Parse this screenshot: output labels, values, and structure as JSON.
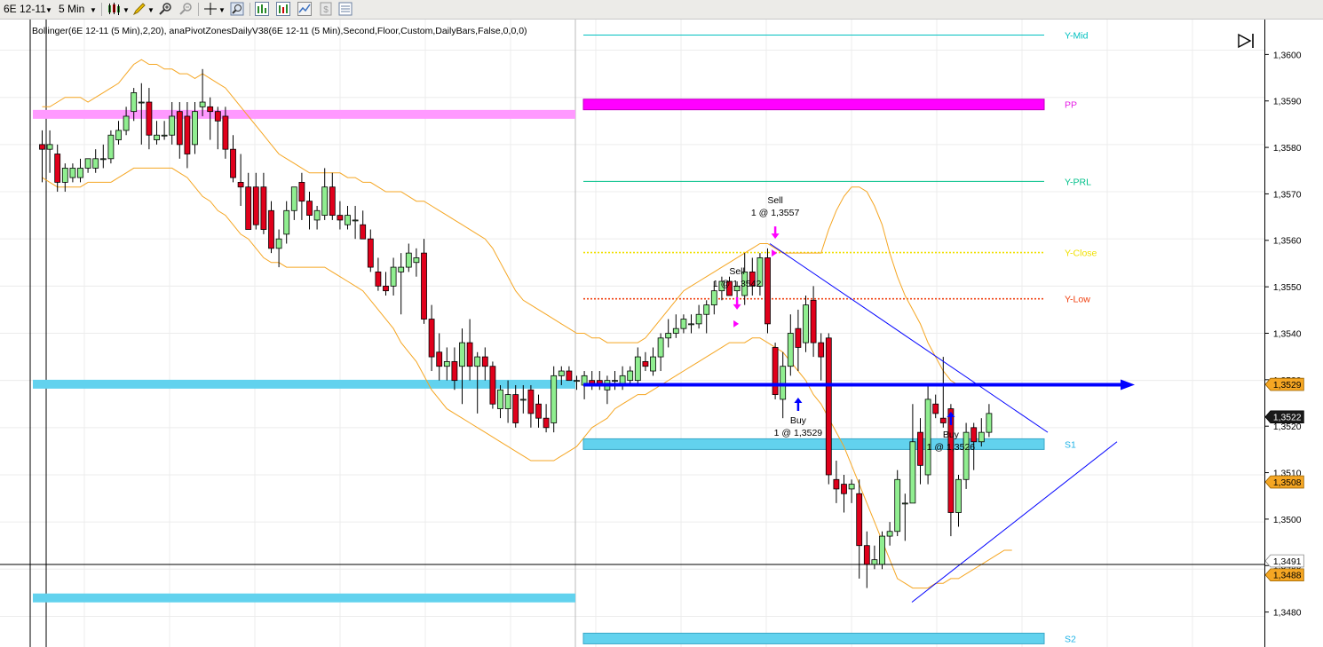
{
  "toolbar": {
    "instrument": "6E 12-11",
    "interval": "5 Min",
    "icons": [
      "candlestick-icon",
      "pencil-icon",
      "zoom-in-icon",
      "zoom-out-icon",
      "crosshair-icon",
      "magnifier-icon",
      "chart-style-icon",
      "indicator-icon",
      "strategy-icon",
      "data-box-icon",
      "properties-icon"
    ]
  },
  "colors": {
    "up_candle": "#90ee90",
    "down_candle": "#e0001b",
    "bollinger": "#f5a623",
    "pp": "#ff00ff",
    "pp_label": "#e61ee6",
    "support": "#62d2ee",
    "support_label": "#1fb3e6",
    "y_mid": "#00c0c0",
    "y_prl": "#00c08a",
    "y_close": "#f0e000",
    "y_low": "#f04010",
    "trend": "#0000ff",
    "sell_arrow": "#ff00ff",
    "buy_arrow": "#0000ff"
  },
  "chart_data": {
    "type": "candlestick",
    "indicator_label": "Bollinger(6E 12-11 (5 Min),2,20), anaPivotZonesDailyV38(6E 12-11 (5 Min),Second,Floor,Custom,DailyBars,False,0,0,0)",
    "y_axis": {
      "ylim": [
        1.34735,
        1.36065
      ],
      "ticks": [
        "1,3480",
        "1,3490",
        "1,3500",
        "1,3510",
        "1,3520",
        "1,3530",
        "1,3540",
        "1,3550",
        "1,3560",
        "1,3570",
        "1,3580",
        "1,3590",
        "1,3600"
      ],
      "tick_values": [
        1.348,
        1.349,
        1.35,
        1.351,
        1.352,
        1.353,
        1.354,
        1.355,
        1.356,
        1.357,
        1.358,
        1.359,
        1.36
      ]
    },
    "price_tags": [
      {
        "text": "1,3529",
        "value": 1.3529,
        "style": "orange"
      },
      {
        "text": "1,3522",
        "value": 1.3522,
        "style": "black"
      },
      {
        "text": "1,3508",
        "value": 1.3508,
        "style": "orange"
      },
      {
        "text": "1,3491",
        "value": 1.3491,
        "style": "gray"
      },
      {
        "text": "1,3488",
        "value": 1.3488,
        "style": "orange"
      }
    ],
    "candles": [
      {
        "o": 1.358,
        "h": 1.3583,
        "l": 1.3572,
        "c": 1.3579
      },
      {
        "o": 1.3579,
        "h": 1.3583,
        "l": 1.3574,
        "c": 1.358
      },
      {
        "o": 1.3578,
        "h": 1.358,
        "l": 1.357,
        "c": 1.3572
      },
      {
        "o": 1.3572,
        "h": 1.3576,
        "l": 1.357,
        "c": 1.3575
      },
      {
        "o": 1.3573,
        "h": 1.3576,
        "l": 1.3572,
        "c": 1.3575
      },
      {
        "o": 1.3573,
        "h": 1.3577,
        "l": 1.3572,
        "c": 1.3575
      },
      {
        "o": 1.3575,
        "h": 1.3577,
        "l": 1.3574,
        "c": 1.3577
      },
      {
        "o": 1.3575,
        "h": 1.3579,
        "l": 1.3574,
        "c": 1.3577
      },
      {
        "o": 1.3577,
        "h": 1.358,
        "l": 1.3575,
        "c": 1.3577
      },
      {
        "o": 1.3577,
        "h": 1.3583,
        "l": 1.3576,
        "c": 1.3582
      },
      {
        "o": 1.3581,
        "h": 1.3585,
        "l": 1.358,
        "c": 1.3583
      },
      {
        "o": 1.3583,
        "h": 1.3588,
        "l": 1.3582,
        "c": 1.3586
      },
      {
        "o": 1.3587,
        "h": 1.3592,
        "l": 1.3585,
        "c": 1.3591
      },
      {
        "o": 1.3589,
        "h": 1.3593,
        "l": 1.358,
        "c": 1.3589
      },
      {
        "o": 1.3589,
        "h": 1.3592,
        "l": 1.3579,
        "c": 1.3582
      },
      {
        "o": 1.3581,
        "h": 1.3585,
        "l": 1.358,
        "c": 1.3582
      },
      {
        "o": 1.3582,
        "h": 1.3585,
        "l": 1.3581,
        "c": 1.3582
      },
      {
        "o": 1.3582,
        "h": 1.3589,
        "l": 1.358,
        "c": 1.3586
      },
      {
        "o": 1.3587,
        "h": 1.3589,
        "l": 1.3577,
        "c": 1.358
      },
      {
        "o": 1.3586,
        "h": 1.3589,
        "l": 1.3575,
        "c": 1.3578
      },
      {
        "o": 1.358,
        "h": 1.3589,
        "l": 1.3578,
        "c": 1.3587
      },
      {
        "o": 1.3588,
        "h": 1.3596,
        "l": 1.3586,
        "c": 1.3589
      },
      {
        "o": 1.3588,
        "h": 1.359,
        "l": 1.3581,
        "c": 1.3587
      },
      {
        "o": 1.3587,
        "h": 1.3588,
        "l": 1.3579,
        "c": 1.3585
      },
      {
        "o": 1.3586,
        "h": 1.3588,
        "l": 1.3577,
        "c": 1.3579
      },
      {
        "o": 1.3579,
        "h": 1.3582,
        "l": 1.3572,
        "c": 1.3573
      },
      {
        "o": 1.3572,
        "h": 1.3578,
        "l": 1.3567,
        "c": 1.3571
      },
      {
        "o": 1.3571,
        "h": 1.3574,
        "l": 1.3562,
        "c": 1.3562
      },
      {
        "o": 1.3571,
        "h": 1.3574,
        "l": 1.3562,
        "c": 1.3563
      },
      {
        "o": 1.3571,
        "h": 1.3574,
        "l": 1.3561,
        "c": 1.3562
      },
      {
        "o": 1.3566,
        "h": 1.3568,
        "l": 1.3557,
        "c": 1.3558
      },
      {
        "o": 1.3558,
        "h": 1.3562,
        "l": 1.3554,
        "c": 1.356
      },
      {
        "o": 1.3561,
        "h": 1.3568,
        "l": 1.3559,
        "c": 1.3566
      },
      {
        "o": 1.3566,
        "h": 1.3571,
        "l": 1.3564,
        "c": 1.3571
      },
      {
        "o": 1.3572,
        "h": 1.3574,
        "l": 1.3564,
        "c": 1.3568
      },
      {
        "o": 1.3568,
        "h": 1.357,
        "l": 1.3562,
        "c": 1.3565
      },
      {
        "o": 1.3564,
        "h": 1.3567,
        "l": 1.3562,
        "c": 1.3566
      },
      {
        "o": 1.3565,
        "h": 1.3575,
        "l": 1.3564,
        "c": 1.3571
      },
      {
        "o": 1.3571,
        "h": 1.3574,
        "l": 1.3564,
        "c": 1.3565
      },
      {
        "o": 1.3565,
        "h": 1.3568,
        "l": 1.3562,
        "c": 1.3564
      },
      {
        "o": 1.3563,
        "h": 1.3567,
        "l": 1.3562,
        "c": 1.3565
      },
      {
        "o": 1.3564,
        "h": 1.3567,
        "l": 1.356,
        "c": 1.3564
      },
      {
        "o": 1.3563,
        "h": 1.3566,
        "l": 1.356,
        "c": 1.356
      },
      {
        "o": 1.356,
        "h": 1.3562,
        "l": 1.3553,
        "c": 1.3554
      },
      {
        "o": 1.3553,
        "h": 1.3556,
        "l": 1.3549,
        "c": 1.355
      },
      {
        "o": 1.355,
        "h": 1.3553,
        "l": 1.3548,
        "c": 1.3549
      },
      {
        "o": 1.355,
        "h": 1.3556,
        "l": 1.3548,
        "c": 1.3554
      },
      {
        "o": 1.3553,
        "h": 1.3557,
        "l": 1.3544,
        "c": 1.3554
      },
      {
        "o": 1.3554,
        "h": 1.3559,
        "l": 1.3553,
        "c": 1.3557
      },
      {
        "o": 1.3555,
        "h": 1.3558,
        "l": 1.3552,
        "c": 1.3556
      },
      {
        "o": 1.3557,
        "h": 1.356,
        "l": 1.3542,
        "c": 1.3543
      },
      {
        "o": 1.3543,
        "h": 1.3546,
        "l": 1.3532,
        "c": 1.3535
      },
      {
        "o": 1.3536,
        "h": 1.354,
        "l": 1.353,
        "c": 1.3533
      },
      {
        "o": 1.3533,
        "h": 1.3537,
        "l": 1.353,
        "c": 1.3534
      },
      {
        "o": 1.3534,
        "h": 1.3537,
        "l": 1.3528,
        "c": 1.353
      },
      {
        "o": 1.3533,
        "h": 1.3541,
        "l": 1.3525,
        "c": 1.3538
      },
      {
        "o": 1.3538,
        "h": 1.3543,
        "l": 1.353,
        "c": 1.3533
      },
      {
        "o": 1.3533,
        "h": 1.3536,
        "l": 1.3523,
        "c": 1.3535
      },
      {
        "o": 1.3535,
        "h": 1.3537,
        "l": 1.353,
        "c": 1.3533
      },
      {
        "o": 1.3533,
        "h": 1.3534,
        "l": 1.3524,
        "c": 1.3525
      },
      {
        "o": 1.3524,
        "h": 1.3529,
        "l": 1.3522,
        "c": 1.3528
      },
      {
        "o": 1.3524,
        "h": 1.353,
        "l": 1.3521,
        "c": 1.3527
      },
      {
        "o": 1.3527,
        "h": 1.3529,
        "l": 1.352,
        "c": 1.3521
      },
      {
        "o": 1.3526,
        "h": 1.3529,
        "l": 1.3523,
        "c": 1.3526
      },
      {
        "o": 1.3528,
        "h": 1.3529,
        "l": 1.352,
        "c": 1.3523
      },
      {
        "o": 1.3525,
        "h": 1.3527,
        "l": 1.352,
        "c": 1.3522
      },
      {
        "o": 1.3522,
        "h": 1.3525,
        "l": 1.3519,
        "c": 1.352
      },
      {
        "o": 1.3521,
        "h": 1.3533,
        "l": 1.3519,
        "c": 1.3531
      },
      {
        "o": 1.3531,
        "h": 1.3533,
        "l": 1.3529,
        "c": 1.3532
      },
      {
        "o": 1.3532,
        "h": 1.3533,
        "l": 1.353,
        "c": 1.353
      },
      {
        "o": 1.353,
        "h": 1.3531,
        "l": 1.3528,
        "c": 1.353
      },
      {
        "o": 1.3529,
        "h": 1.3532,
        "l": 1.3526,
        "c": 1.3531
      },
      {
        "o": 1.353,
        "h": 1.3532,
        "l": 1.3528,
        "c": 1.3529
      },
      {
        "o": 1.353,
        "h": 1.3532,
        "l": 1.3528,
        "c": 1.3529
      },
      {
        "o": 1.3528,
        "h": 1.3531,
        "l": 1.3525,
        "c": 1.353
      },
      {
        "o": 1.353,
        "h": 1.3532,
        "l": 1.3528,
        "c": 1.353
      },
      {
        "o": 1.3529,
        "h": 1.3533,
        "l": 1.3528,
        "c": 1.3531
      },
      {
        "o": 1.353,
        "h": 1.3533,
        "l": 1.3529,
        "c": 1.3532
      },
      {
        "o": 1.353,
        "h": 1.3537,
        "l": 1.3529,
        "c": 1.3535
      },
      {
        "o": 1.3534,
        "h": 1.3536,
        "l": 1.3532,
        "c": 1.3533
      },
      {
        "o": 1.3532,
        "h": 1.3537,
        "l": 1.3531,
        "c": 1.3535
      },
      {
        "o": 1.3535,
        "h": 1.354,
        "l": 1.3532,
        "c": 1.3539
      },
      {
        "o": 1.3539,
        "h": 1.3543,
        "l": 1.3537,
        "c": 1.354
      },
      {
        "o": 1.354,
        "h": 1.3544,
        "l": 1.3539,
        "c": 1.3541
      },
      {
        "o": 1.3541,
        "h": 1.3544,
        "l": 1.354,
        "c": 1.3543
      },
      {
        "o": 1.3542,
        "h": 1.3544,
        "l": 1.354,
        "c": 1.3542
      },
      {
        "o": 1.3542,
        "h": 1.3546,
        "l": 1.3541,
        "c": 1.3544
      },
      {
        "o": 1.3544,
        "h": 1.3547,
        "l": 1.354,
        "c": 1.3546
      },
      {
        "o": 1.3546,
        "h": 1.3551,
        "l": 1.3544,
        "c": 1.3549
      },
      {
        "o": 1.3549,
        "h": 1.3552,
        "l": 1.3547,
        "c": 1.3551
      },
      {
        "o": 1.3551,
        "h": 1.3552,
        "l": 1.3548,
        "c": 1.3548
      },
      {
        "o": 1.3549,
        "h": 1.3551,
        "l": 1.3547,
        "c": 1.355
      },
      {
        "o": 1.3548,
        "h": 1.3557,
        "l": 1.3546,
        "c": 1.3553
      },
      {
        "o": 1.3553,
        "h": 1.3556,
        "l": 1.3548,
        "c": 1.355
      },
      {
        "o": 1.355,
        "h": 1.3557,
        "l": 1.3548,
        "c": 1.3556
      },
      {
        "o": 1.3556,
        "h": 1.3558,
        "l": 1.354,
        "c": 1.3542
      },
      {
        "o": 1.3537,
        "h": 1.3538,
        "l": 1.3526,
        "c": 1.3527
      },
      {
        "o": 1.3526,
        "h": 1.3536,
        "l": 1.3522,
        "c": 1.3533
      },
      {
        "o": 1.3533,
        "h": 1.3544,
        "l": 1.3531,
        "c": 1.354
      },
      {
        "o": 1.3541,
        "h": 1.3545,
        "l": 1.3532,
        "c": 1.3537
      },
      {
        "o": 1.3538,
        "h": 1.3548,
        "l": 1.3536,
        "c": 1.3546
      },
      {
        "o": 1.3547,
        "h": 1.355,
        "l": 1.3535,
        "c": 1.3538
      },
      {
        "o": 1.3538,
        "h": 1.354,
        "l": 1.353,
        "c": 1.3535
      },
      {
        "o": 1.3539,
        "h": 1.354,
        "l": 1.3508,
        "c": 1.351
      },
      {
        "o": 1.3509,
        "h": 1.3513,
        "l": 1.3504,
        "c": 1.3507
      },
      {
        "o": 1.3508,
        "h": 1.351,
        "l": 1.3502,
        "c": 1.3506
      },
      {
        "o": 1.3507,
        "h": 1.3509,
        "l": 1.3504,
        "c": 1.3508
      },
      {
        "o": 1.3506,
        "h": 1.3509,
        "l": 1.3488,
        "c": 1.3495
      },
      {
        "o": 1.3495,
        "h": 1.3498,
        "l": 1.3486,
        "c": 1.3491
      },
      {
        "o": 1.3491,
        "h": 1.3495,
        "l": 1.349,
        "c": 1.3492
      },
      {
        "o": 1.3491,
        "h": 1.3498,
        "l": 1.349,
        "c": 1.3497
      },
      {
        "o": 1.3497,
        "h": 1.35,
        "l": 1.3495,
        "c": 1.3498
      },
      {
        "o": 1.3498,
        "h": 1.3511,
        "l": 1.3497,
        "c": 1.3509
      },
      {
        "o": 1.3504,
        "h": 1.3506,
        "l": 1.3496,
        "c": 1.3504
      },
      {
        "o": 1.3504,
        "h": 1.3525,
        "l": 1.3504,
        "c": 1.3517
      },
      {
        "o": 1.3519,
        "h": 1.3522,
        "l": 1.3508,
        "c": 1.3512
      },
      {
        "o": 1.351,
        "h": 1.3529,
        "l": 1.3508,
        "c": 1.3526
      },
      {
        "o": 1.3525,
        "h": 1.3527,
        "l": 1.3522,
        "c": 1.3523
      },
      {
        "o": 1.3522,
        "h": 1.3535,
        "l": 1.352,
        "c": 1.3521
      },
      {
        "o": 1.3524,
        "h": 1.3525,
        "l": 1.3497,
        "c": 1.3502
      },
      {
        "o": 1.3502,
        "h": 1.351,
        "l": 1.3499,
        "c": 1.3509
      },
      {
        "o": 1.3509,
        "h": 1.3521,
        "l": 1.3507,
        "c": 1.3519
      },
      {
        "o": 1.352,
        "h": 1.3521,
        "l": 1.3511,
        "c": 1.3517
      },
      {
        "o": 1.3517,
        "h": 1.3522,
        "l": 1.3516,
        "c": 1.3519
      },
      {
        "o": 1.3519,
        "h": 1.3525,
        "l": 1.3518,
        "c": 1.3523
      }
    ],
    "bollinger_upper": [
      1.3588,
      1.3588,
      1.3589,
      1.359,
      1.359,
      1.359,
      1.3589,
      1.359,
      1.3591,
      1.3592,
      1.3593,
      1.3595,
      1.3597,
      1.3598,
      1.3597,
      1.3597,
      1.3596,
      1.3596,
      1.3595,
      1.3595,
      1.3594,
      1.3595,
      1.3594,
      1.3593,
      1.3592,
      1.359,
      1.3588,
      1.3586,
      1.3584,
      1.3582,
      1.358,
      1.3578,
      1.3577,
      1.3576,
      1.3575,
      1.3574,
      1.3574,
      1.3574,
      1.3574,
      1.3574,
      1.3573,
      1.3573,
      1.3572,
      1.3572,
      1.3571,
      1.357,
      1.357,
      1.357,
      1.3569,
      1.3568,
      1.3568,
      1.3567,
      1.3566,
      1.3565,
      1.3564,
      1.3563,
      1.3562,
      1.3561,
      1.356,
      1.3558,
      1.3555,
      1.3552,
      1.3549,
      1.3547,
      1.3546,
      1.3545,
      1.3544,
      1.3543,
      1.3542,
      1.3541,
      1.354,
      1.354,
      1.3539,
      1.3539,
      1.3538,
      1.3538,
      1.3538,
      1.3538,
      1.3538,
      1.3539,
      1.3541,
      1.3543,
      1.3545,
      1.3547,
      1.3549,
      1.355,
      1.3551,
      1.3552,
      1.3553,
      1.3554,
      1.3555,
      1.3556,
      1.3557,
      1.3558,
      1.3559,
      1.3559,
      1.3558,
      1.3557,
      1.3557,
      1.3557,
      1.3557,
      1.3557,
      1.3557,
      1.3562,
      1.3566,
      1.3569,
      1.3571,
      1.3571,
      1.357,
      1.3567,
      1.3563,
      1.3557,
      1.3552,
      1.3548,
      1.3545,
      1.3542,
      1.3538,
      1.3535,
      1.3532,
      1.353,
      1.3529,
      1.3529,
      1.3529,
      1.3529,
      1.3529,
      1.3529,
      1.3529
    ],
    "bollinger_lower": [
      1.3573,
      1.3572,
      1.3571,
      1.3571,
      1.3571,
      1.3571,
      1.3572,
      1.3572,
      1.3572,
      1.3572,
      1.3573,
      1.3574,
      1.3575,
      1.3575,
      1.3575,
      1.3575,
      1.3575,
      1.3575,
      1.3574,
      1.3573,
      1.3571,
      1.3569,
      1.3568,
      1.3566,
      1.3565,
      1.3563,
      1.3561,
      1.356,
      1.3558,
      1.3556,
      1.3555,
      1.3555,
      1.3554,
      1.3554,
      1.3554,
      1.3554,
      1.3554,
      1.3554,
      1.3553,
      1.3552,
      1.3551,
      1.355,
      1.3549,
      1.3547,
      1.3545,
      1.3543,
      1.3541,
      1.3538,
      1.3536,
      1.3534,
      1.3531,
      1.3528,
      1.3526,
      1.3524,
      1.3523,
      1.3522,
      1.3521,
      1.352,
      1.3519,
      1.3518,
      1.3517,
      1.3516,
      1.3515,
      1.3514,
      1.3513,
      1.3513,
      1.3513,
      1.3513,
      1.3514,
      1.3515,
      1.3516,
      1.3518,
      1.352,
      1.3521,
      1.3522,
      1.3524,
      1.3525,
      1.3526,
      1.3527,
      1.3527,
      1.3528,
      1.3529,
      1.353,
      1.3531,
      1.3532,
      1.3533,
      1.3534,
      1.3535,
      1.3536,
      1.3537,
      1.3538,
      1.3538,
      1.3538,
      1.3539,
      1.3539,
      1.3538,
      1.3537,
      1.3536,
      1.3534,
      1.3532,
      1.353,
      1.3527,
      1.3525,
      1.3522,
      1.3519,
      1.3516,
      1.3512,
      1.3508,
      1.3504,
      1.35,
      1.3496,
      1.3492,
      1.3488,
      1.3487,
      1.3486,
      1.3486,
      1.3486,
      1.3487,
      1.3487,
      1.3488,
      1.3488,
      1.3489,
      1.349,
      1.3491,
      1.3492,
      1.3493,
      1.3494,
      1.3494
    ],
    "levels": [
      {
        "name": "Y-Mid",
        "value": 1.36032,
        "style": "line",
        "color": "#00c0c0"
      },
      {
        "name": "PP",
        "value": 1.35885,
        "style": "zone",
        "color": "#ff00ff"
      },
      {
        "name": "Y-PRL",
        "value": 1.35722,
        "style": "line",
        "color": "#00c08a"
      },
      {
        "name": "Y-Close",
        "value": 1.35571,
        "style": "dotted",
        "color": "#f0e000"
      },
      {
        "name": "Y-Low",
        "value": 1.35473,
        "style": "dotted",
        "color": "#f04010"
      },
      {
        "name": "S1",
        "value": 1.35165,
        "style": "zone",
        "color": "#62d2ee"
      },
      {
        "name": "S2",
        "value": 1.34753,
        "style": "zone",
        "color": "#62d2ee"
      }
    ],
    "prior_zones": [
      {
        "value": 1.35864,
        "color": "#ff99ff"
      },
      {
        "value": 1.35292,
        "color": "#62d2ee"
      },
      {
        "value": 1.34839,
        "color": "#62d2ee"
      }
    ],
    "horizontal_ray": {
      "value": 1.35291
    },
    "crosshair_price": 1.3491,
    "trades": [
      {
        "type": "sell",
        "title": "Sell",
        "detail": "1 @ 1,3542",
        "bar": 91,
        "value": 1.3542
      },
      {
        "type": "sell",
        "title": "Sell",
        "detail": "1 @ 1,3557",
        "bar": 96,
        "value": 1.3557
      },
      {
        "type": "buy",
        "title": "Buy",
        "detail": "1 @ 1,3529",
        "bar": 99,
        "value": 1.3529
      },
      {
        "type": "buy",
        "title": "Buy",
        "detail": "1 @ 1,3526",
        "bar": 119,
        "value": 1.3526
      }
    ]
  }
}
